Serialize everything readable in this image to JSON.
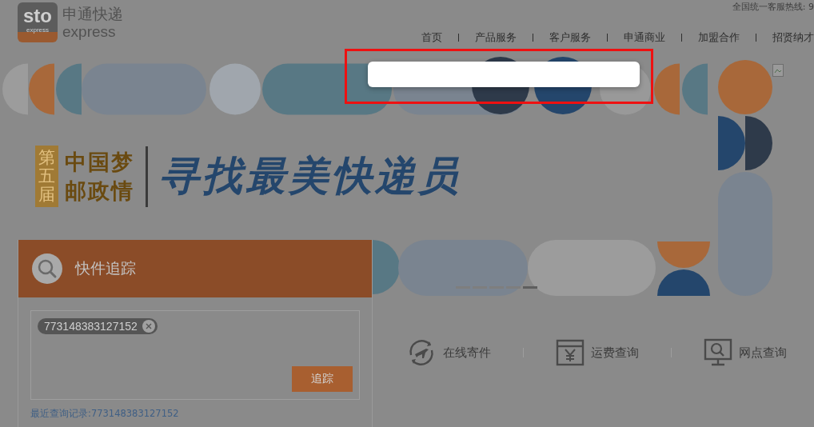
{
  "header": {
    "logo": {
      "mark": "sto",
      "mark_sub": "express",
      "name": "申通快递",
      "name_en": "express"
    },
    "hotline": "全国统一客服热线: 9",
    "nav": [
      {
        "label": "首页"
      },
      {
        "label": "产品服务"
      },
      {
        "label": "客户服务"
      },
      {
        "label": "申通商业"
      },
      {
        "label": "加盟合作"
      },
      {
        "label": "招贤纳才"
      }
    ]
  },
  "banner": {
    "badge": "第五届",
    "slogan_lines": [
      "中国梦",
      "邮政情"
    ],
    "headline": "寻找最美快递员",
    "slides": [
      {
        "selected": false
      },
      {
        "selected": false
      },
      {
        "selected": false
      },
      {
        "selected": false
      },
      {
        "selected": true
      }
    ]
  },
  "tracking": {
    "title": "快件追踪",
    "numbers": [
      "773148383127152"
    ],
    "button": "追踪",
    "recent_label": "最近查询记录:",
    "recent_number": "773148383127152"
  },
  "quick_links": [
    {
      "kind": "send",
      "label": "在线寄件"
    },
    {
      "kind": "fee",
      "label": "运费查询"
    },
    {
      "kind": "outlet",
      "label": "网点查询"
    }
  ]
}
